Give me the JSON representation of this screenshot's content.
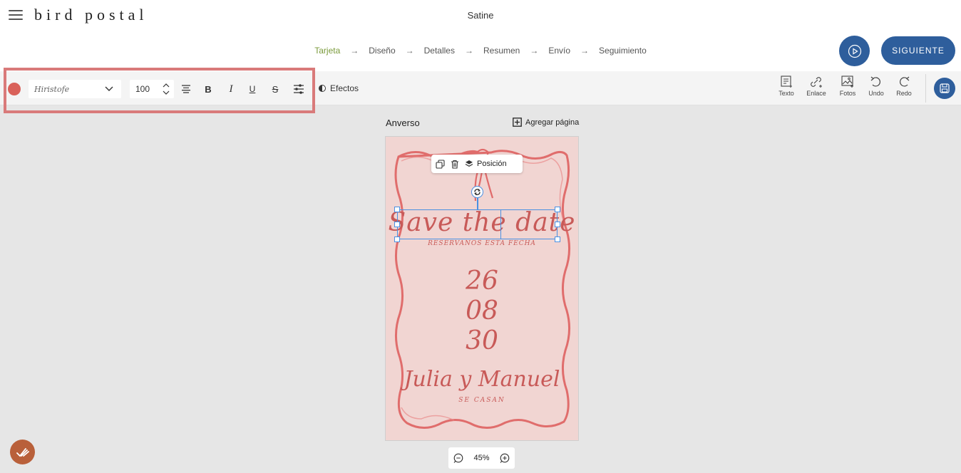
{
  "app": {
    "logo": "bird postal",
    "document_title": "Satine"
  },
  "steps": [
    {
      "label": "Tarjeta",
      "active": true
    },
    {
      "label": "Diseño",
      "active": false
    },
    {
      "label": "Detalles",
      "active": false
    },
    {
      "label": "Resumen",
      "active": false
    },
    {
      "label": "Envío",
      "active": false
    },
    {
      "label": "Seguimiento",
      "active": false
    }
  ],
  "header": {
    "next_label": "SIGUIENTE"
  },
  "toolbar": {
    "text_color": "#d9615a",
    "font_name": "Hiristofe",
    "font_size": "100",
    "effects_label": "Efectos",
    "bold_label": "B",
    "italic_label": "I",
    "underline_label": "U",
    "strike_label": "S"
  },
  "right_tools": [
    {
      "label": "Texto",
      "icon": "text-box-icon"
    },
    {
      "label": "Enlace",
      "icon": "link-icon"
    },
    {
      "label": "Fotos",
      "icon": "image-icon"
    },
    {
      "label": "Undo",
      "icon": "undo-icon"
    },
    {
      "label": "Redo",
      "icon": "redo-icon"
    }
  ],
  "canvas": {
    "side_label": "Anverso",
    "add_page_label": "Agregar página"
  },
  "floating_toolbar": {
    "position_label": "Posición"
  },
  "card": {
    "headline": "Save the date",
    "subtitle": "RESERVANOS ESTA FECHA",
    "day": "26",
    "month": "08",
    "year": "30",
    "names": "Julia y Manuel",
    "tagline": "SE CASAN"
  },
  "zoom": {
    "level": "45%"
  },
  "colors": {
    "brand": "#2e5e9c",
    "active_step": "#7a9a3b",
    "accent_text": "#c85a58",
    "highlight_frame": "#d97a7a",
    "help_button": "#b9603a"
  }
}
